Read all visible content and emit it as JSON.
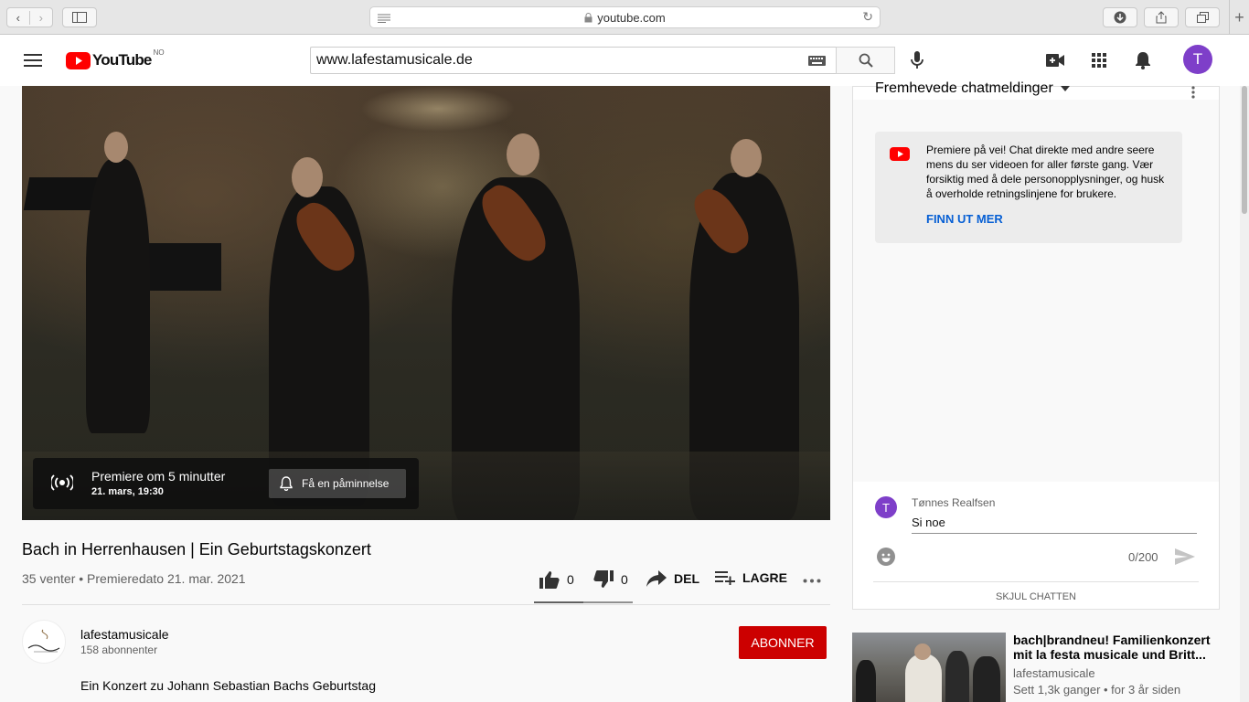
{
  "browser": {
    "url": "youtube.com"
  },
  "header": {
    "logo_text": "YouTube",
    "region": "NO",
    "search_value": "www.lafestamusicale.de",
    "avatar_letter": "T"
  },
  "video": {
    "premiere_title": "Premiere om 5 minutter",
    "premiere_date": "21. mars, 19:30",
    "reminder_label": "Få en påminnelse"
  },
  "info": {
    "title": "Bach in Herrenhausen | Ein Geburtstagskonzert",
    "meta": "35 venter • Premieredato 21. mar. 2021",
    "likes": "0",
    "dislikes": "0",
    "share_label": "DEL",
    "save_label": "LAGRE"
  },
  "channel": {
    "name": "lafestamusicale",
    "subscribers": "158 abonnenter",
    "subscribe_label": "ABONNER",
    "description": "Ein Konzert zu Johann Sebastian Bachs Geburtstag"
  },
  "chat": {
    "header": "Fremhevede chatmeldinger",
    "notice_text": "Premiere på vei! Chat direkte med andre seere mens du ser videoen for aller første gang. Vær forsiktig med å dele personopplysninger, og husk å overholde retningslinjene for brukere.",
    "notice_link": "FINN UT MER",
    "user_name": "Tønnes Realfsen",
    "user_initial": "T",
    "input_placeholder": "Si noe",
    "char_count": "0/200",
    "hide_label": "SKJUL CHATTEN"
  },
  "recommendation": {
    "title": "bach|brandneu! Familienkonzert mit la festa musicale und Britt...",
    "channel": "lafestamusicale",
    "stats": "Sett 1,3k ganger • for 3 år siden"
  },
  "colors": {
    "youtube_red": "#ff0000",
    "subscribe_red": "#cc0000",
    "avatar_purple": "#7e3fc9",
    "link_blue": "#065fd4"
  }
}
